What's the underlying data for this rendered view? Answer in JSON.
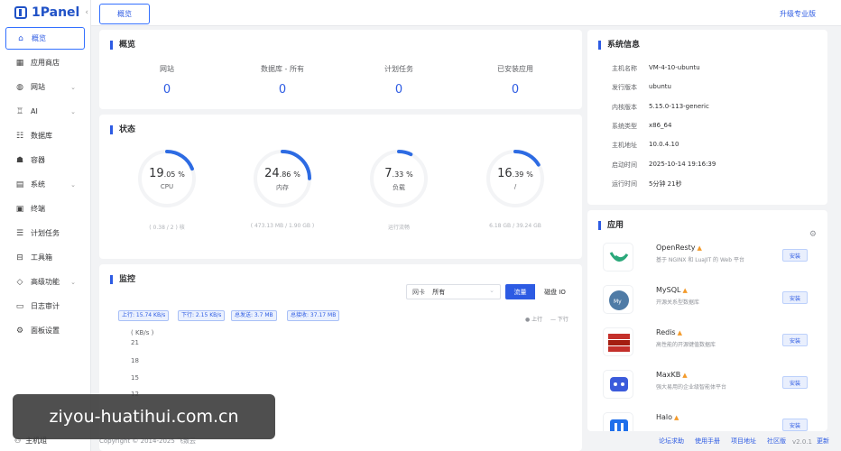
{
  "app": {
    "logo": "1Panel"
  },
  "sidebar": {
    "items": [
      {
        "label": "概览",
        "icon": "home-icon",
        "arrow": false,
        "active": true
      },
      {
        "label": "应用商店",
        "icon": "grid-icon",
        "arrow": false
      },
      {
        "label": "网站",
        "icon": "globe-icon",
        "arrow": true
      },
      {
        "label": "AI",
        "icon": "robot-icon",
        "arrow": true
      },
      {
        "label": "数据库",
        "icon": "database-icon",
        "arrow": false
      },
      {
        "label": "容器",
        "icon": "container-icon",
        "arrow": false
      },
      {
        "label": "系统",
        "icon": "system-icon",
        "arrow": true
      },
      {
        "label": "终端",
        "icon": "terminal-icon",
        "arrow": false
      },
      {
        "label": "计划任务",
        "icon": "schedule-icon",
        "arrow": false
      },
      {
        "label": "工具箱",
        "icon": "toolbox-icon",
        "arrow": false
      },
      {
        "label": "高级功能",
        "icon": "diamond-icon",
        "arrow": true
      },
      {
        "label": "日志审计",
        "icon": "log-icon",
        "arrow": false
      },
      {
        "label": "面板设置",
        "icon": "settings-icon",
        "arrow": false
      }
    ],
    "bottom": "主机组"
  },
  "topbar": {
    "tab": "概览",
    "upgrade": "升级专业版"
  },
  "overview": {
    "title": "概览",
    "stats": [
      {
        "label": "网站",
        "value": "0"
      },
      {
        "label": "数据库 - 所有",
        "value": "0"
      },
      {
        "label": "计划任务",
        "value": "0"
      },
      {
        "label": "已安装应用",
        "value": "0"
      }
    ]
  },
  "status": {
    "title": "状态",
    "gauges": [
      {
        "int": "19",
        "dec": ".05",
        "unit": "%",
        "label": "CPU",
        "sub": "( 0.38 / 2 ) 核",
        "percent": 19.05
      },
      {
        "int": "24",
        "dec": ".86",
        "unit": "%",
        "label": "内存",
        "sub": "( 473.13 MB / 1.90 GB )",
        "percent": 24.86
      },
      {
        "int": "7",
        "dec": ".33",
        "unit": "%",
        "label": "负载",
        "sub": "运行流畅",
        "percent": 7.33
      },
      {
        "int": "16",
        "dec": ".39",
        "unit": "%",
        "label": "/",
        "sub": "6.18 GB / 39.24 GB",
        "percent": 16.39
      }
    ]
  },
  "monitor": {
    "title": "监控",
    "nic_label": "网卡",
    "nic_value": "所有",
    "btn_traffic": "流量",
    "btn_disk": "磁盘 IO",
    "tags": [
      "上行: 15.74 KB/s",
      "下行: 2.15 KB/s",
      "总发送: 3.7 MB",
      "总接收: 37.17 MB"
    ],
    "legend_up": "上行",
    "legend_down": "下行",
    "ylabel": "( KB/s )",
    "yticks": [
      "21",
      "18",
      "15",
      "12"
    ]
  },
  "sysinfo": {
    "title": "系统信息",
    "rows": [
      {
        "k": "主机名称",
        "v": "VM-4-10-ubuntu"
      },
      {
        "k": "发行版本",
        "v": "ubuntu"
      },
      {
        "k": "内核版本",
        "v": "5.15.0-113-generic"
      },
      {
        "k": "系统类型",
        "v": "x86_64"
      },
      {
        "k": "主机地址",
        "v": "10.0.4.10"
      },
      {
        "k": "启动时间",
        "v": "2025-10-14 19:16:39"
      },
      {
        "k": "运行时间",
        "v": "5分钟 21秒"
      }
    ]
  },
  "apps": {
    "title": "应用",
    "items": [
      {
        "name": "OpenResty",
        "desc": "基于 NGINX 和 LuaJIT 的 Web 平台",
        "btn": "安装",
        "color": "#ffffff"
      },
      {
        "name": "MySQL",
        "desc": "开源关系型数据库",
        "btn": "安装",
        "color": "#ffffff"
      },
      {
        "name": "Redis",
        "desc": "高性能的开源键值数据库",
        "btn": "安装",
        "color": "#ffffff"
      },
      {
        "name": "MaxKB",
        "desc": "强大易用的企业级智能体平台",
        "btn": "安装",
        "color": "#ffffff"
      },
      {
        "name": "Halo",
        "desc": "",
        "btn": "安装",
        "color": "#ffffff"
      }
    ]
  },
  "footer": {
    "copyright": "Copyright © 2014-2025 飞致云",
    "links": [
      "论坛求助",
      "使用手册",
      "项目地址",
      "社区版",
      "v2.0.1",
      "更新"
    ]
  },
  "watermark": "ziyou-huatihui.com.cn"
}
